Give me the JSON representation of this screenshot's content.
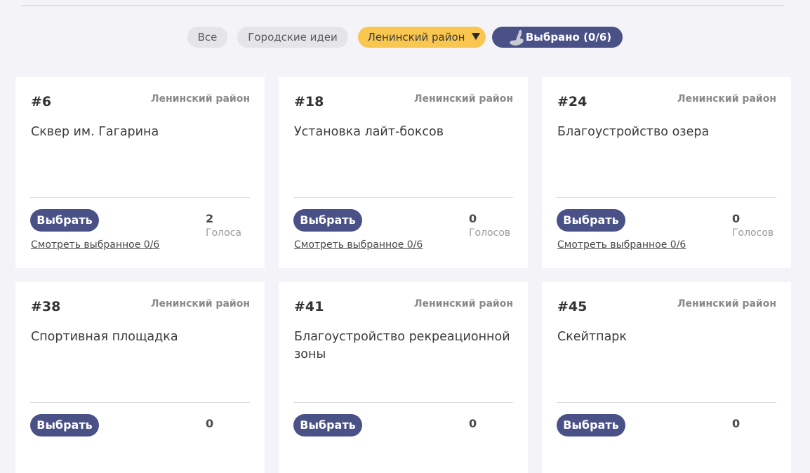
{
  "filters": {
    "all": "Все",
    "city_ideas": "Городские идеи",
    "district": "Ленинский район",
    "selected": "Выбрано (0/6)"
  },
  "cards": [
    {
      "id": "#6",
      "district": "Ленинский район",
      "title": "Сквер им. Гагарина",
      "votes": "2",
      "votes_label": "Голоса",
      "button": "Выбрать",
      "link": "Смотреть выбранное 0/6"
    },
    {
      "id": "#18",
      "district": "Ленинский район",
      "title": "Установка лайт-боксов",
      "votes": "0",
      "votes_label": "Голосов",
      "button": "Выбрать",
      "link": "Смотреть выбранное 0/6"
    },
    {
      "id": "#24",
      "district": "Ленинский район",
      "title": "Благоустройство озера",
      "votes": "0",
      "votes_label": "Голосов",
      "button": "Выбрать",
      "link": "Смотреть выбранное 0/6"
    },
    {
      "id": "#38",
      "district": "Ленинский район",
      "title": "Спортивная площадка",
      "votes": "0",
      "votes_label": "",
      "button": "Выбрать",
      "link": ""
    },
    {
      "id": "#41",
      "district": "Ленинский район",
      "title": "Благоустройство рекреационной зоны",
      "votes": "0",
      "votes_label": "",
      "button": "Выбрать",
      "link": ""
    },
    {
      "id": "#45",
      "district": "Ленинский район",
      "title": "Скейтпарк",
      "votes": "0",
      "votes_label": "",
      "button": "Выбрать",
      "link": ""
    }
  ],
  "colors": {
    "accent": "#4a5187",
    "district_chip": "#f9c74f",
    "background": "#f4f3f7"
  }
}
